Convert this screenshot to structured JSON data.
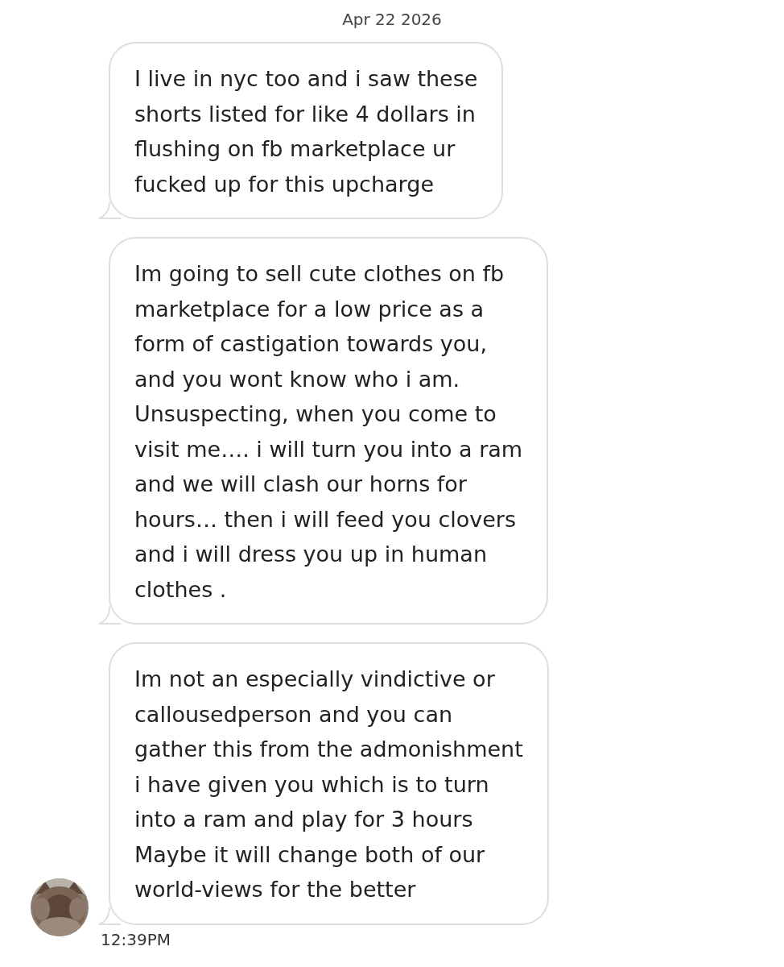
{
  "date": "Apr 22 2026",
  "messages": [
    {
      "lines": [
        "I live in nyc too and i saw these",
        "shorts listed for like 4 dollars in",
        "flushing  on fb marketplace ur",
        "fucked up for this upcharge"
      ]
    },
    {
      "lines": [
        "Im going to sell cute clothes on fb",
        "marketplace for a low price as a",
        "form of castigation towards you,",
        "and you wont know who i am.",
        "Unsuspecting, when you come to",
        "visit me…. i will turn you into a ram",
        "and we will clash our horns for",
        "hours… then i will feed you clovers",
        "and i will dress you up in human",
        "clothes ."
      ]
    },
    {
      "lines": [
        "Im not an especially vindictive or",
        "callousedperson and you can",
        "gather this from the admonishment",
        "i have given you which is to turn",
        "into a ram and play for 3 hours",
        "Maybe it will change both of our",
        "world-views for the better"
      ]
    }
  ],
  "time": "12:39PM"
}
